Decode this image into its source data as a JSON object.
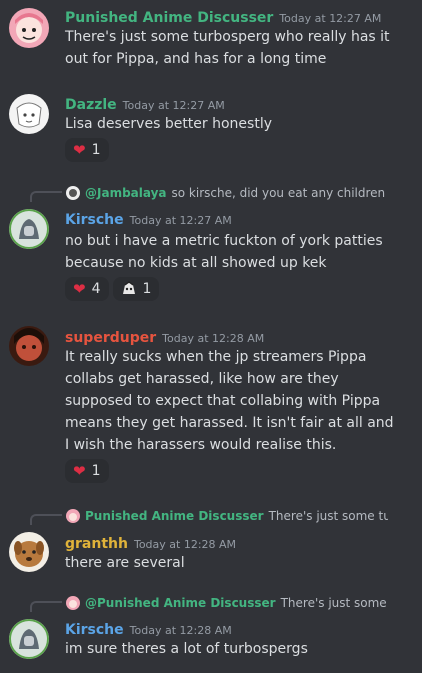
{
  "messages": [
    {
      "author": "Punished Anime Discusser",
      "author_color": "#43b581",
      "timestamp": "Today at 12:27 AM",
      "lines": [
        "There's just some turbosperg who really has it",
        "out for Pippa, and has for a long time"
      ]
    },
    {
      "author": "Dazzle",
      "author_color": "#43b581",
      "timestamp": "Today at 12:27 AM",
      "lines": [
        "Lisa deserves better honestly"
      ],
      "reactions": [
        {
          "emoji": "heart-icon",
          "count": "1"
        }
      ]
    },
    {
      "reply": {
        "author": "@Jambalaya",
        "text": "so kirsche, did you eat any children th"
      },
      "author": "Kirsche",
      "author_color": "#5ba4e6",
      "timestamp": "Today at 12:27 AM",
      "lines": [
        "no but i have a metric fuckton of york patties",
        "because no kids at all showed up kek"
      ],
      "reactions": [
        {
          "emoji": "heart-icon",
          "count": "4"
        },
        {
          "emoji": "custom-emote-icon",
          "count": "1"
        }
      ]
    },
    {
      "author": "superduper",
      "author_color": "#e6543f",
      "timestamp": "Today at 12:28 AM",
      "lines": [
        "It really sucks when the jp streamers Pippa",
        "collabs get harassed, like how are they",
        "supposed to expect that collabing with Pippa",
        "means they get harassed.  It isn't fair at all and",
        "I wish the harassers would realise this."
      ],
      "reactions": [
        {
          "emoji": "heart-icon",
          "count": "1"
        }
      ]
    },
    {
      "reply": {
        "author": "Punished Anime Discusser",
        "text": "There's just some turbo"
      },
      "author": "granthh",
      "author_color": "#e0b33a",
      "timestamp": "Today at 12:28 AM",
      "lines": [
        "there are several"
      ]
    },
    {
      "reply": {
        "author": "@Punished Anime Discusser",
        "text": "There's just some turl"
      },
      "author": "Kirsche",
      "author_color": "#5ba4e6",
      "timestamp": "Today at 12:28 AM",
      "lines": [
        "im sure theres a lot of turbospergs"
      ]
    }
  ]
}
